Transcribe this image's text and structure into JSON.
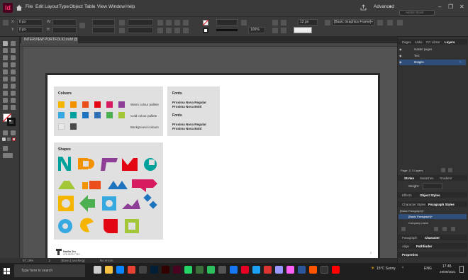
{
  "app": {
    "icon_label": "Id"
  },
  "menu": [
    "File",
    "Edit",
    "Layout",
    "Type",
    "Object",
    "Table",
    "View",
    "Window",
    "Help"
  ],
  "workspace": {
    "label": "Advanced",
    "search_placeholder": "Adobe Stock"
  },
  "control": {
    "x_value": "0 px",
    "y_value": "0 px",
    "w_label": "W:",
    "h_label": "H:",
    "stroke_weight": "12 px",
    "opacity": "100%",
    "frame_style": "[Basic Graphics Frame]+"
  },
  "document": {
    "tab_title": "INTERVIEW PORTFOLIO.indd @ 57%"
  },
  "status": {
    "zoom": "57.19%",
    "page": "2",
    "style": "[Basic] (working)",
    "errors": "No errors"
  },
  "page_content": {
    "colours_title": "Colours",
    "palettes": [
      {
        "label": "Warm colour pallete",
        "colors": [
          "#f5b400",
          "#f39200",
          "#e94e1b",
          "#e30613",
          "#d81b60",
          "#8e3e96"
        ]
      },
      {
        "label": "Cold colour pallete",
        "colors": [
          "#36a9e1",
          "#009fa0",
          "#1e73be",
          "#2e6fb6",
          "#4caf50",
          "#a4c639"
        ]
      },
      {
        "label": "Background colours",
        "colors": [
          "#e8e8e8",
          "#4a4a4a"
        ]
      }
    ],
    "fonts_title": "Fonts",
    "fonts_groups": [
      {
        "title": "Fonts",
        "items": [
          "Proxima Nova Regular",
          "Proxima Nova Bold"
        ]
      }
    ],
    "font_items": [
      "Proxima Nova Regular",
      "Proxima Nova Bold",
      "Proxima Nova Regular",
      "Proxima Nova Bold"
    ],
    "shapes_title": "Shapes",
    "footer_name": "Nadia Jin",
    "footer_phone": "075 0575 7743",
    "page_number": "2"
  },
  "panels": {
    "top_tabs": [
      "Pages",
      "Links",
      "CC Librar",
      "Layers"
    ],
    "layers": [
      "master pages",
      "Text",
      "Images"
    ],
    "layers_footer": "Page: 2, 3 Layers",
    "stroke_tabs": [
      "Stroke",
      "Swatches",
      "Gradient"
    ],
    "weight_label": "Weight:",
    "effects_tabs": [
      "Effects",
      "Object Styles"
    ],
    "char_tabs": [
      "Character Styles",
      "Paragraph Styles"
    ],
    "para_styles": [
      "[Basic Paragraph]+",
      "[Basic Paragraph]+",
      "Company name"
    ],
    "bottom_tabs": [
      "Paragraph",
      "Character"
    ],
    "align_tabs": [
      "Align",
      "Pathfinder"
    ],
    "properties": "Properties"
  },
  "taskbar": {
    "search_placeholder": "Type here to search",
    "weather": "15°C  Sunny",
    "lang": "ENG",
    "time": "17:45",
    "date": "29/09/2021"
  }
}
